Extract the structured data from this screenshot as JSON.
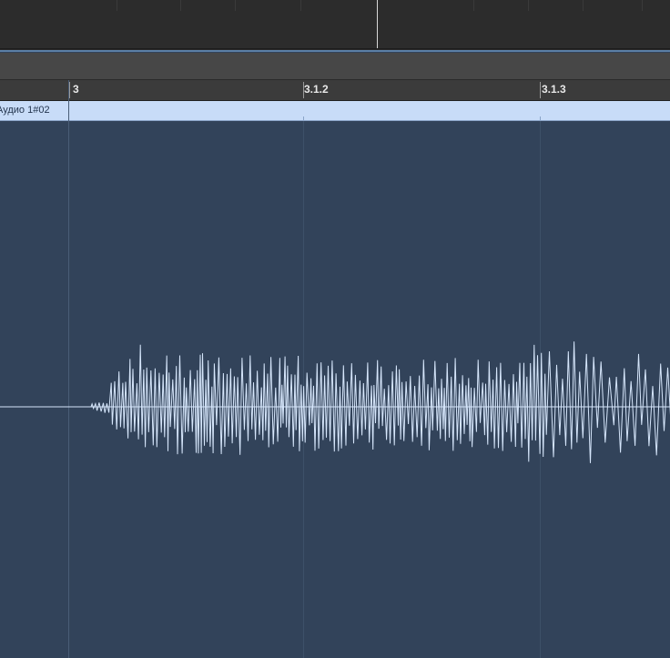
{
  "ruler": {
    "markers": [
      "3",
      "3.1.2",
      "3.1.3"
    ]
  },
  "region": {
    "name": "Аудио 1#02"
  },
  "colors": {
    "background": "#32435a",
    "waveform": "#d6e6fb",
    "region_header": "#c8dcf8"
  }
}
